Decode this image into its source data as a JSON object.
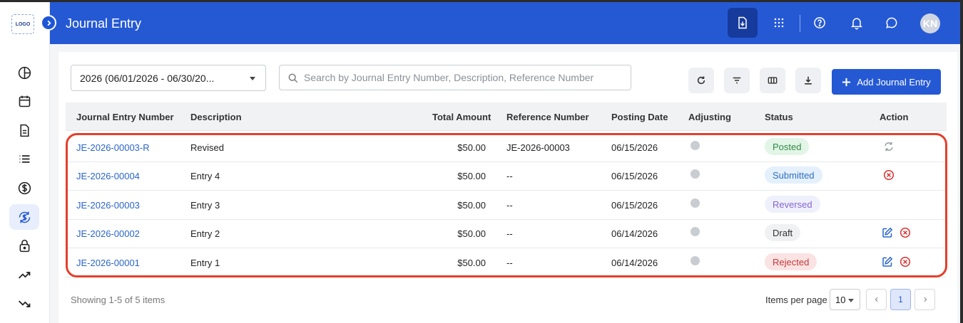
{
  "app": {
    "logo_text": "LOGO",
    "page_title": "Journal Entry",
    "avatar_initials": "KN"
  },
  "colors": {
    "header_bg": "#2559d4",
    "link": "#2a65c9",
    "highlight_border": "#e43f2b"
  },
  "sidebar": {
    "items": [
      {
        "icon": "pie-chart-icon"
      },
      {
        "icon": "calendar-icon"
      },
      {
        "icon": "document-icon"
      },
      {
        "icon": "list-icon"
      },
      {
        "icon": "dollar-icon"
      },
      {
        "icon": "dollar-exchange-icon",
        "active": true
      },
      {
        "icon": "lock-icon"
      },
      {
        "icon": "trending-up-icon"
      },
      {
        "icon": "trending-down-icon"
      }
    ]
  },
  "header": {
    "icons": [
      "import-icon",
      "apps-grid-icon",
      "help-icon",
      "bell-icon",
      "chat-icon"
    ]
  },
  "toolbar": {
    "period_select_value": "2026 (06/01/2026 - 06/30/20...",
    "search_placeholder": "Search by Journal Entry Number, Description, Reference Number",
    "search_value": "",
    "add_button_label": "Add Journal Entry"
  },
  "table": {
    "columns": [
      "Journal Entry Number",
      "Description",
      "Total Amount",
      "Reference Number",
      "Posting Date",
      "Adjusting",
      "Status",
      "Action"
    ],
    "rows": [
      {
        "number": "JE-2026-00003-R",
        "description": "Revised",
        "amount": "$50.00",
        "reference": "JE-2026-00003",
        "date": "06/15/2026",
        "status": "Posted",
        "actions": [
          "sync"
        ]
      },
      {
        "number": "JE-2026-00004",
        "description": "Entry 4",
        "amount": "$50.00",
        "reference": "--",
        "date": "06/15/2026",
        "status": "Submitted",
        "actions": [
          "cancel"
        ]
      },
      {
        "number": "JE-2026-00003",
        "description": "Entry 3",
        "amount": "$50.00",
        "reference": "--",
        "date": "06/15/2026",
        "status": "Reversed",
        "actions": []
      },
      {
        "number": "JE-2026-00002",
        "description": "Entry 2",
        "amount": "$50.00",
        "reference": "--",
        "date": "06/14/2026",
        "status": "Draft",
        "actions": [
          "edit",
          "cancel"
        ]
      },
      {
        "number": "JE-2026-00001",
        "description": "Entry 1",
        "amount": "$50.00",
        "reference": "--",
        "date": "06/14/2026",
        "status": "Rejected",
        "actions": [
          "edit",
          "cancel"
        ]
      }
    ]
  },
  "status_styles": {
    "Posted": {
      "bg": "#e3f5e6",
      "fg": "#2e8b46"
    },
    "Submitted": {
      "bg": "#e4f0fc",
      "fg": "#2f6fc4"
    },
    "Reversed": {
      "bg": "#eef1fb",
      "fg": "#8a63d2"
    },
    "Draft": {
      "bg": "#f0f1f3",
      "fg": "#333333"
    },
    "Rejected": {
      "bg": "#fbe3e3",
      "fg": "#c23a3a"
    }
  },
  "footer": {
    "showing_text": "Showing 1-5 of 5 items",
    "items_per_page_label": "Items per page",
    "items_per_page_value": "10",
    "current_page": "1"
  }
}
